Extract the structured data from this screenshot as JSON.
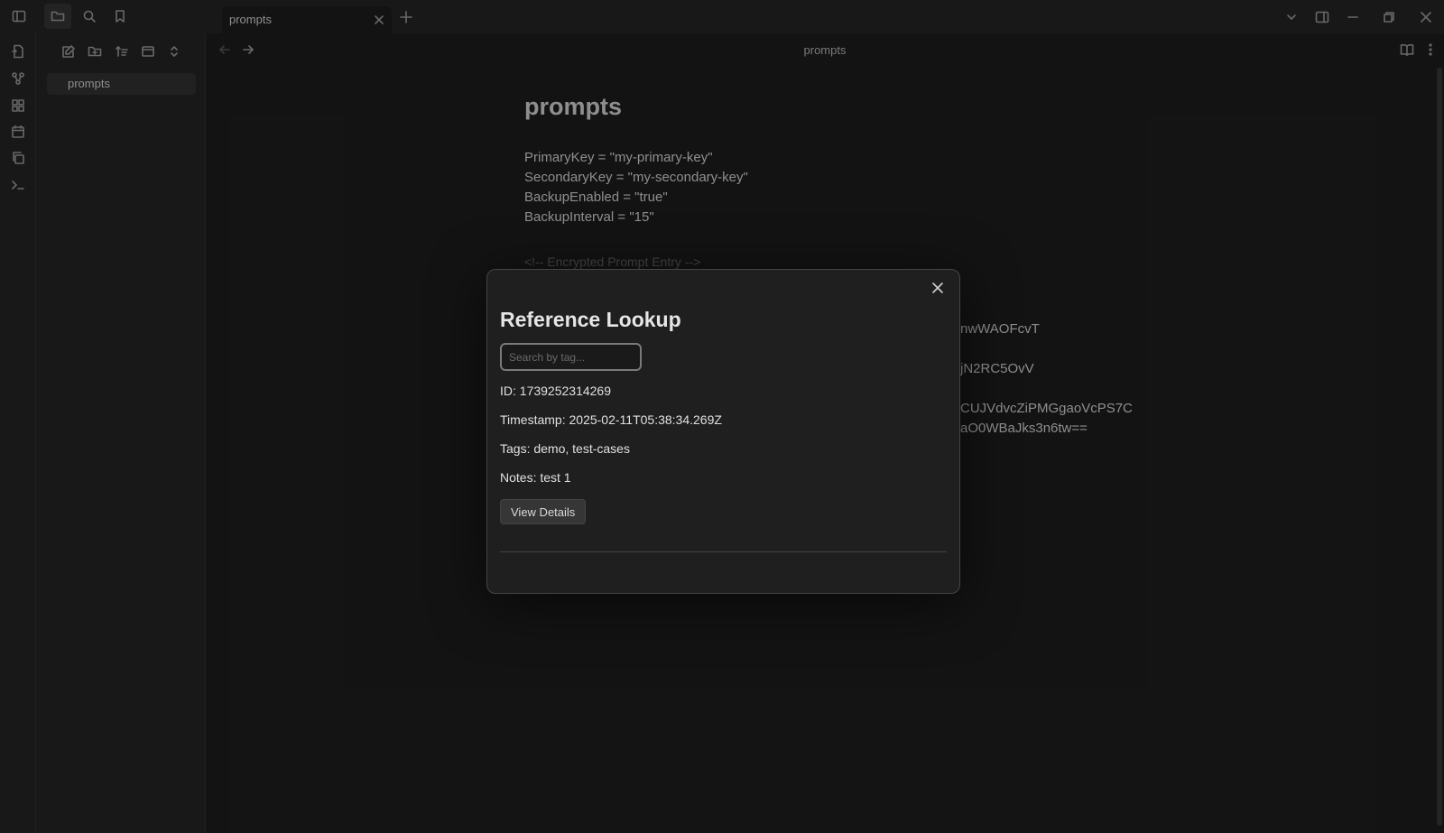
{
  "tab": {
    "title": "prompts"
  },
  "sidebar": {
    "files": [
      {
        "label": "prompts"
      }
    ]
  },
  "view": {
    "title": "prompts"
  },
  "note": {
    "title": "prompts",
    "kv_lines": [
      "PrimaryKey = \"my-primary-key\"",
      "SecondaryKey = \"my-secondary-key\"",
      "BackupEnabled = \"true\"",
      "BackupInterval = \"15\""
    ],
    "faded_comment": "<!-- Encrypted Prompt Entry -->",
    "encrypted_fragments": [
      "nwWAOFcvT",
      "jN2RC5OvV",
      "CUJVdvcZiPMGgaoVcPS7C",
      "aO0WBaJks3n6tw=="
    ]
  },
  "modal": {
    "title": "Reference Lookup",
    "search_placeholder": "Search by tag...",
    "fields": {
      "id": "ID: 1739252314269",
      "timestamp": "Timestamp: 2025-02-11T05:38:34.269Z",
      "tags": "Tags: demo, test-cases",
      "notes": "Notes: test 1"
    },
    "button_label": "View Details"
  }
}
